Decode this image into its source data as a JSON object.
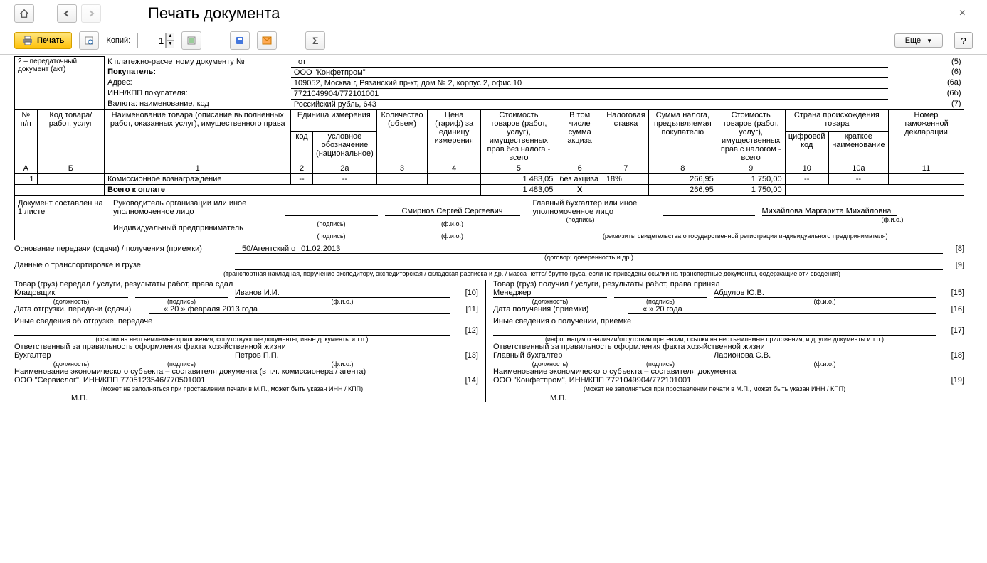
{
  "window": {
    "title": "Печать документа"
  },
  "toolbar": {
    "print": "Печать",
    "copies_label": "Копий:",
    "copies_value": "1",
    "more": "Еще",
    "help": "?"
  },
  "header": {
    "doc_type_num": "2 – передаточный документ (акт)",
    "payment_doc_label": "К платежно-расчетному документу №",
    "payment_from": "от",
    "buyer_label": "Покупатель:",
    "buyer_value": "ООО \"Конфетпром\"",
    "address_label": "Адрес:",
    "address_value": "109052, Москва г, Рязанский пр-кт, дом № 2, корпус 2, офис 10",
    "inn_label": "ИНН/КПП покупателя:",
    "inn_value": "7721049904/772101001",
    "currency_label": "Валюта: наименование, код",
    "currency_value": "Российский рубль, 643",
    "codes": {
      "c5": "(5)",
      "c6": "(6)",
      "c6a": "(6а)",
      "c6b": "(6б)",
      "c7": "(7)"
    }
  },
  "table_headers": {
    "num": "№ п/п",
    "code": "Код товара/ работ, услуг",
    "name": "Наименование товара (описание выполненных работ, оказанных услуг), имущественного права",
    "unit": "Единица измерения",
    "unit_code": "код",
    "unit_name": "условное обозначение (национальное)",
    "qty": "Количество (объем)",
    "price": "Цена (тариф) за единицу измерения",
    "cost_no_tax": "Стоимость товаров (работ, услуг), имущественных прав без налога - всего",
    "excise": "В том числе сумма акциза",
    "tax_rate": "Налоговая ставка",
    "tax_sum": "Сумма налога, предъявляемая покупателю",
    "cost_with_tax": "Стоимость товаров (работ, услуг), имущественных прав с налогом - всего",
    "country": "Страна происхождения товара",
    "country_code": "цифровой код",
    "country_name": "краткое наименование",
    "decl": "Номер таможенной декларации",
    "colA": "А",
    "colB": "Б",
    "col1": "1",
    "col2": "2",
    "col2a": "2а",
    "col3": "3",
    "col4": "4",
    "col5": "5",
    "col6": "6",
    "col7": "7",
    "col8": "8",
    "col9": "9",
    "col10": "10",
    "col10a": "10а",
    "col11": "11"
  },
  "rows": [
    {
      "num": "1",
      "name": "Комиссионное вознаграждение",
      "unit_code": "--",
      "unit_name": "--",
      "cost_no_tax": "1 483,05",
      "excise": "без акциза",
      "tax_rate": "18%",
      "tax_sum": "266,95",
      "cost_with_tax": "1 750,00",
      "country_code": "--",
      "country_name": "--"
    }
  ],
  "totals": {
    "label": "Всего к оплате",
    "cost_no_tax": "1 483,05",
    "excise": "Х",
    "tax_sum": "266,95",
    "cost_with_tax": "1 750,00"
  },
  "signatures": {
    "composed_label": "Документ составлен на",
    "sheets": "1 листе",
    "head_org": "Руководитель организации или иное уполномоченное лицо",
    "head_name": "Смирнов Сергей Сергеевич",
    "chief_acc": "Главный бухгалтер или иное уполномоченное лицо",
    "chief_acc_name": "Михайлова Маргарита Михайловна",
    "ip": "Индивидуальный предприниматель",
    "sig_caption": "(подпись)",
    "fio_caption": "(ф.и.о.)",
    "ip_caption": "(реквизиты свидетельства о государственной регистрации индивидуального предпринимателя)",
    "basis_label": "Основание передачи (сдачи) / получения (приемки)",
    "basis_value": "50/Агентский от 01.02.2013",
    "basis_caption": "(договор; доверенность и др.)",
    "basis_code": "[8]",
    "transport_label": "Данные о транспортировке и грузе",
    "transport_caption": "(транспортная накладная, поручение экспедитору, экспедиторская / складская расписка и др. / масса нетто/ брутто груза, если не приведены ссылки на транспортные документы, содержащие эти сведения)",
    "transport_code": "[9]"
  },
  "left": {
    "handover_label": "Товар (груз) передал / услуги, результаты работ, права сдал",
    "handover_role": "Кладовщик",
    "handover_name": "Иванов И.И.",
    "handover_code": "[10]",
    "ship_date_label": "Дата отгрузки, передачи (сдачи)",
    "ship_date": "« 20 »    февраля   2013   года",
    "ship_date_code": "[11]",
    "other_ship_label": "Иные сведения об отгрузке, передаче",
    "other_ship_caption": "(ссылки на неотъемлемые приложения, сопутствующие документы, иные документы и т.п.)",
    "other_ship_code": "[12]",
    "resp_label": "Ответственный за правильность оформления факта хозяйственной жизни",
    "resp_role": "Бухгалтер",
    "resp_name": "Петров П.П.",
    "resp_code": "[13]",
    "entity_label": "Наименование экономического субъекта – составителя документа (в т.ч. комиссионера / агента)",
    "entity_value": "ООО \"Сервислог\", ИНН/КПП 7705123546/770501001",
    "entity_caption": "(может не заполняться при проставлении печати в М.П., может быть указан ИНН / КПП)",
    "entity_code": "[14]",
    "mp": "М.П."
  },
  "right": {
    "receive_label": "Товар (груз) получил / услуги, результаты работ, права принял",
    "receive_role": "Менеджер",
    "receive_name": "Абдулов Ю.В.",
    "receive_code": "[15]",
    "rcv_date_label": "Дата получения (приемки)",
    "rcv_date": "«       »                        20       года",
    "rcv_date_code": "[16]",
    "other_rcv_label": "Иные сведения о получении, приемке",
    "other_rcv_caption": "(информация о наличии/отсутствии претензии; ссылки на неотъемлемые приложения, и другие документы и т.п.)",
    "other_rcv_code": "[17]",
    "resp_label": "Ответственный за правильность оформления факта хозяйственной жизни",
    "resp_role": "Главный бухгалтер",
    "resp_name": "Ларионова С.В.",
    "resp_code": "[18]",
    "entity_label": "Наименование экономического субъекта – составителя документа",
    "entity_value": "ООО \"Конфетпром\", ИНН/КПП 7721049904/772101001",
    "entity_caption": "(может не заполняться при проставлении печати в М.П., может быть указан ИНН / КПП)",
    "entity_code": "[19]",
    "mp": "М.П."
  },
  "captions": {
    "role": "(должность)",
    "sig": "(подпись)",
    "fio": "(ф.и.о.)"
  }
}
